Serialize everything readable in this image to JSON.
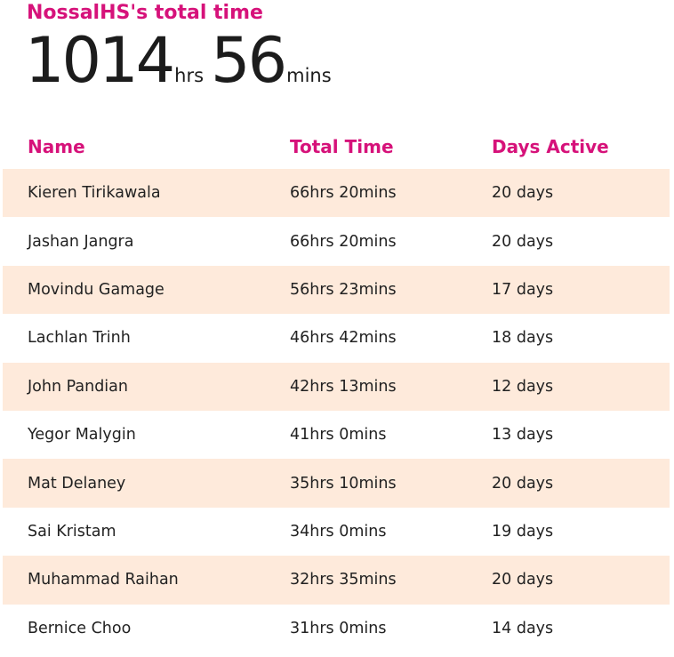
{
  "summary": {
    "title": "NossalHS's total time",
    "hours": "1014",
    "hours_unit": "hrs",
    "minutes": "56",
    "minutes_unit": "mins"
  },
  "table": {
    "headers": {
      "name": "Name",
      "total_time": "Total Time",
      "days_active": "Days Active"
    },
    "rows": [
      {
        "name": "Kieren Tirikawala",
        "total_time": "66hrs 20mins",
        "days_active": "20 days"
      },
      {
        "name": "Jashan Jangra",
        "total_time": "66hrs 20mins",
        "days_active": "20 days"
      },
      {
        "name": "Movindu Gamage",
        "total_time": "56hrs 23mins",
        "days_active": "17 days"
      },
      {
        "name": "Lachlan Trinh",
        "total_time": "46hrs 42mins",
        "days_active": "18 days"
      },
      {
        "name": "John Pandian",
        "total_time": "42hrs 13mins",
        "days_active": "12 days"
      },
      {
        "name": "Yegor Malygin",
        "total_time": "41hrs 0mins",
        "days_active": "13 days"
      },
      {
        "name": "Mat Delaney",
        "total_time": "35hrs 10mins",
        "days_active": "20 days"
      },
      {
        "name": "Sai Kristam",
        "total_time": "34hrs 0mins",
        "days_active": "19 days"
      },
      {
        "name": "Muhammad Raihan",
        "total_time": "32hrs 35mins",
        "days_active": "20 days"
      },
      {
        "name": "Bernice Choo",
        "total_time": "31hrs 0mins",
        "days_active": "14 days"
      }
    ]
  },
  "colors": {
    "accent": "#d6127a",
    "row_shade": "#feeadb",
    "text": "#222222"
  }
}
